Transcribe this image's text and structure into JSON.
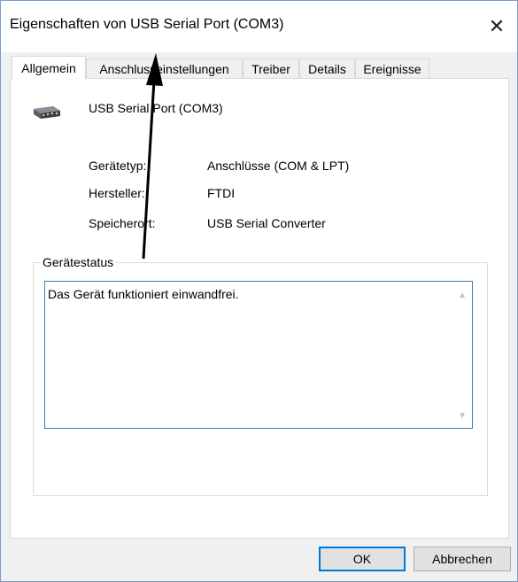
{
  "window": {
    "title": "Eigenschaften von USB Serial Port (COM3)",
    "close_glyph": "✕"
  },
  "tabs": [
    {
      "label": "Allgemein",
      "active": true
    },
    {
      "label": "Anschlusseinstellungen",
      "active": false
    },
    {
      "label": "Treiber",
      "active": false
    },
    {
      "label": "Details",
      "active": false
    },
    {
      "label": "Ereignisse",
      "active": false
    }
  ],
  "device": {
    "icon": "serial-port-connector-icon",
    "name": "USB Serial Port (COM3)"
  },
  "properties": [
    {
      "label": "Gerätetyp:",
      "value": "Anschlüsse (COM & LPT)"
    },
    {
      "label": "Hersteller:",
      "value": "FTDI"
    },
    {
      "label": "Speicherort:",
      "value": "USB Serial Converter"
    }
  ],
  "status": {
    "group_title": "Gerätestatus",
    "text": "Das Gerät funktioniert einwandfrei."
  },
  "buttons": {
    "ok": "OK",
    "cancel": "Abbrechen"
  },
  "colors": {
    "accent": "#0078d7",
    "focus_border": "#3c7fb1"
  }
}
